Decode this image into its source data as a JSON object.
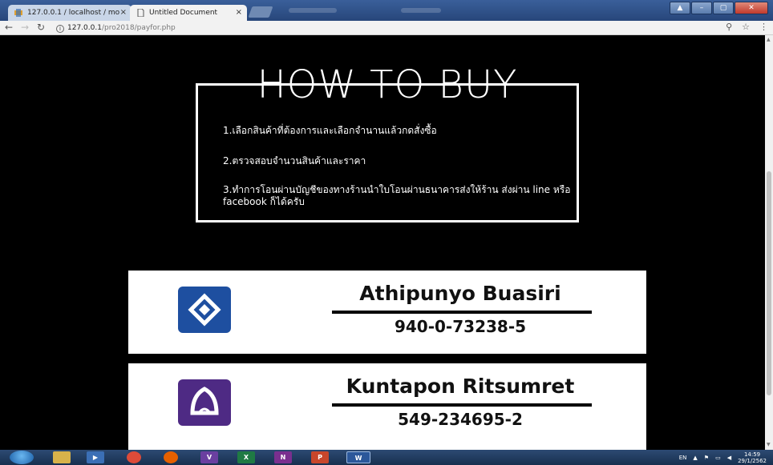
{
  "browser": {
    "tabs": [
      {
        "label": "127.0.0.1 / localhost / mo",
        "active": false
      },
      {
        "label": "Untitled Document",
        "active": true
      }
    ],
    "url_host": "127.0.0.1",
    "url_path": "/pro2018/payfor.php"
  },
  "page": {
    "title": "HOW TO BUY",
    "steps": [
      "1.เลือกสินค้าที่ต้องการและเลือกจำนานแล้วกดสั่งซื้อ",
      "2.ตรวจสอบจำนวนสินค้าและราคา",
      "3.ทำการโอนผ่านบัญชีของทางร้านนำใบโอนผ่านธนาคารส่งให้ร้าน ส่งผ่าน line หรือ facebook ก็ได้ครับ"
    ],
    "accounts": [
      {
        "name": "Athipunyo Buasiri",
        "number": "940-0-73238-5",
        "bank_icon": "bangkok-bank-logo",
        "color": "#1e4fa0"
      },
      {
        "name": "Kuntapon Ritsumret",
        "number": "549-234695-2",
        "bank_icon": "siam-commercial-bank-logo",
        "color": "#4e2a84"
      }
    ]
  },
  "taskbar": {
    "language": "EN",
    "time": "14:59",
    "date": "29/1/2562",
    "apps": [
      "V",
      "X",
      "N",
      "P",
      "W"
    ]
  }
}
